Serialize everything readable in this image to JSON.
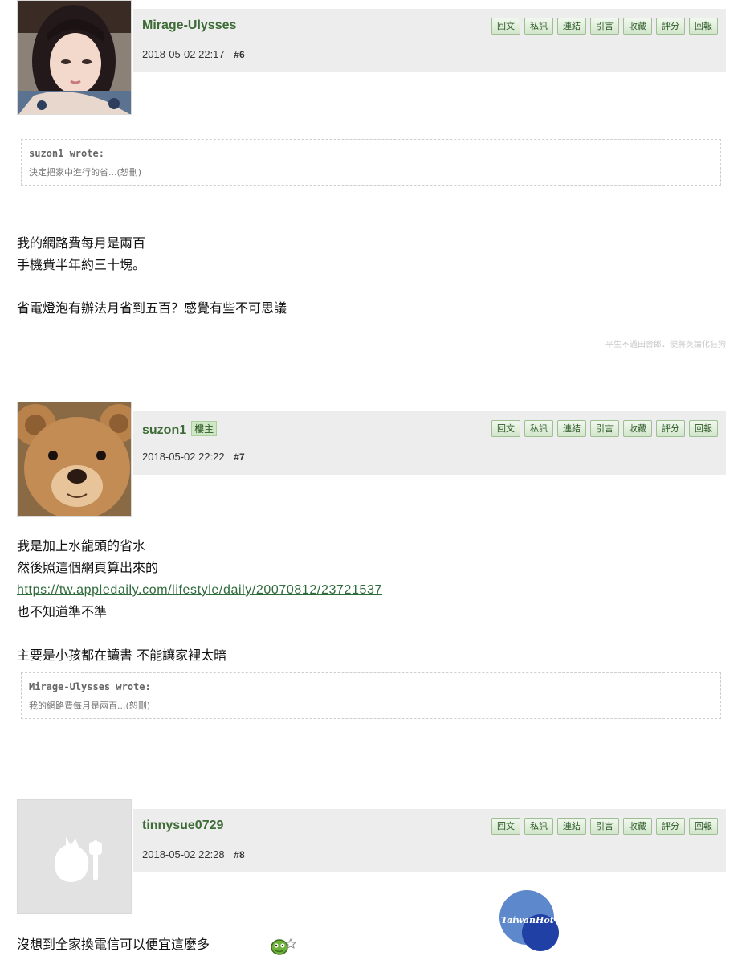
{
  "buttons": [
    "回文",
    "私訊",
    "連結",
    "引言",
    "收藏",
    "評分",
    "回報"
  ],
  "post6": {
    "username": "Mirage-Ulysses",
    "datetime": "2018-05-02 22:17",
    "floor": "#6",
    "quote_author": "suzon1 wrote:",
    "quote_text": "決定把家中進行的省...(恕刪)",
    "lines": [
      "我的網路費每月是兩百",
      "手機費半年約三十塊。",
      "",
      "省電燈泡有辦法月省到五百？感覺有些不可思議"
    ],
    "signature": "平生不過田舍郎．便將英論化狂狗"
  },
  "post7": {
    "username": "suzon1",
    "badge": "樓主",
    "datetime": "2018-05-02 22:22",
    "floor": "#7",
    "lines_before": [
      "我是加上水龍頭的省水",
      "然後照這個網頁算出來的"
    ],
    "link": "https://tw.appledaily.com/lifestyle/daily/20070812/23721537",
    "lines_after": [
      "也不知道準不準",
      "",
      "主要是小孩都在讀書 不能讓家裡太暗"
    ],
    "quote_author": "Mirage-Ulysses wrote:",
    "quote_text": "我的網路費每月是兩百...(恕刪)"
  },
  "post8": {
    "username": "tinnysue0729",
    "datetime": "2018-05-02 22:28",
    "floor": "#8",
    "text": "沒想到全家換電信可以便宜這麼多"
  },
  "watermark": "TaiwanHot",
  "colors": {
    "accent_green": "#3d6b36",
    "header_bg": "#ededed",
    "button_bg": "#d3e6cc"
  },
  "icons": {
    "emoticon": "green-smiley-icon"
  }
}
